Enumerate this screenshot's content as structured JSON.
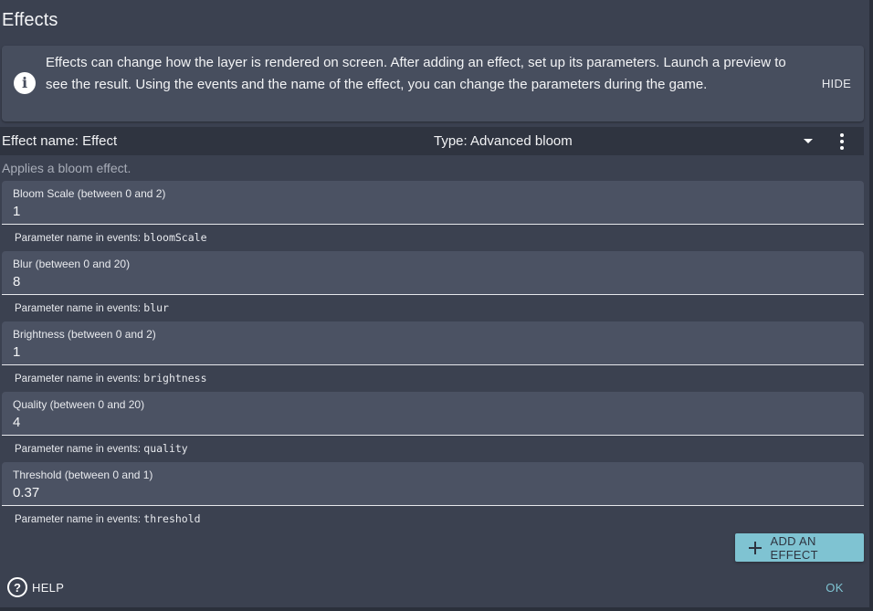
{
  "dialog": {
    "title": "Effects",
    "info": {
      "icon": "info-icon",
      "text": "Effects can change how the layer is rendered on screen. After adding an effect, set up its parameters. Launch a preview to see the result. Using the events and the name of the effect, you can change the parameters during the game.",
      "hide_label": "HIDE"
    },
    "effect": {
      "name_label": "Effect name: Effect",
      "type_label": "Type: Advanced bloom",
      "description": "Applies a bloom effect."
    },
    "param_prefix": "Parameter name in events: ",
    "fields": [
      {
        "label": "Bloom Scale (between 0 and 2)",
        "value": "1",
        "param": "bloomScale"
      },
      {
        "label": "Blur (between 0 and 20)",
        "value": "8",
        "param": "blur"
      },
      {
        "label": "Brightness (between 0 and 2)",
        "value": "1",
        "param": "brightness"
      },
      {
        "label": "Quality (between 0 and 20)",
        "value": "4",
        "param": "quality"
      },
      {
        "label": "Threshold (between 0 and 1)",
        "value": "0.37",
        "param": "threshold"
      }
    ],
    "add_effect_label": "ADD AN EFFECT",
    "help_label": "HELP",
    "ok_label": "OK"
  },
  "colors": {
    "background": "#3b4150",
    "info_panel": "#474e5e",
    "effect_bar": "#2f3440",
    "field_bg": "#4b5263",
    "accent": "#7fc3d2"
  }
}
